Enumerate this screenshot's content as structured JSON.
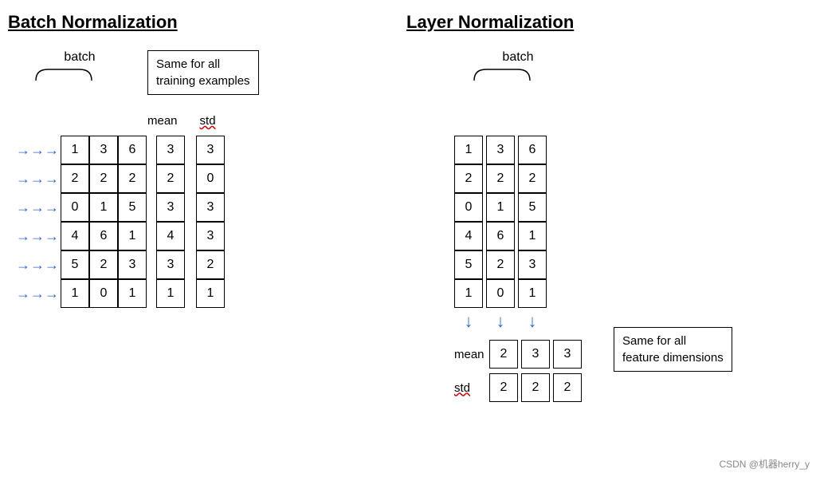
{
  "bn": {
    "title": "Batch Normalization",
    "batch_label": "batch",
    "tooltip": "Same for all\ntraining examples",
    "mean_label": "mean",
    "std_label": "std",
    "matrix": [
      [
        1,
        3,
        6
      ],
      [
        2,
        2,
        2
      ],
      [
        0,
        1,
        5
      ],
      [
        4,
        6,
        1
      ],
      [
        5,
        2,
        3
      ],
      [
        1,
        0,
        1
      ]
    ],
    "means": [
      3,
      2,
      3,
      4,
      3,
      1
    ],
    "stds": [
      3,
      0,
      3,
      3,
      2,
      1
    ]
  },
  "ln": {
    "title": "Layer Normalization",
    "batch_label": "batch",
    "tooltip": "Same for all\nfeature dimensions",
    "mean_label": "mean",
    "std_label": "std",
    "matrix": [
      [
        1,
        3,
        6
      ],
      [
        2,
        2,
        2
      ],
      [
        0,
        1,
        5
      ],
      [
        4,
        6,
        1
      ],
      [
        5,
        2,
        3
      ],
      [
        1,
        0,
        1
      ]
    ],
    "means": [
      2,
      3,
      3
    ],
    "stds": [
      2,
      2,
      2
    ]
  },
  "watermark": "CSDN @机器herry_y"
}
